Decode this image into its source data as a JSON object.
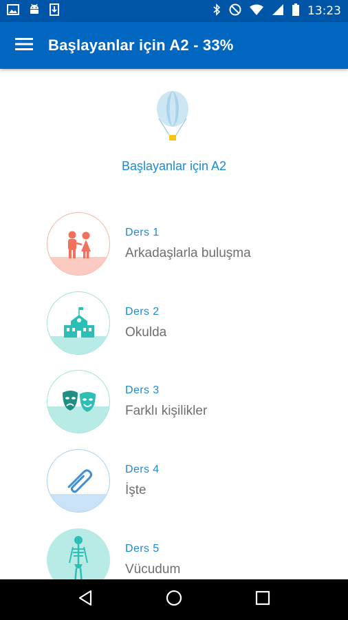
{
  "status_bar": {
    "time": "13:23",
    "left_icons": [
      "image-icon",
      "android-icon",
      "download-icon"
    ],
    "right_icons": [
      "bluetooth-icon",
      "do-not-disturb-icon",
      "wifi-icon",
      "signal-icon",
      "battery-icon"
    ]
  },
  "app_bar": {
    "title": "Başlayanlar için A2 - 33%",
    "background": "#0066c0"
  },
  "course": {
    "title": "Başlayanlar için A2",
    "icon": "hot-air-balloon-icon",
    "flag": "uk-flag-icon"
  },
  "lessons": [
    {
      "number": "Ders 1",
      "name": "Arkadaşlarla buluşma",
      "icon": "friends-icon",
      "color": "#f2705c"
    },
    {
      "number": "Ders 2",
      "name": "Okulda",
      "icon": "school-icon",
      "color": "#2dbfb6"
    },
    {
      "number": "Ders 3",
      "name": "Farklı kişilikler",
      "icon": "theater-masks-icon",
      "color": "#23a79a"
    },
    {
      "number": "Ders 4",
      "name": "İşte",
      "icon": "paperclip-icon",
      "color": "#3f8fd6"
    },
    {
      "number": "Ders 5",
      "name": "Vücudum",
      "icon": "skeleton-icon",
      "color": "#2dbfb6"
    }
  ],
  "colors": {
    "accent": "#1a8ad4",
    "status_bar": "#0055a6",
    "secondary_text": "#6f6f6f"
  },
  "nav_bar": {
    "buttons": [
      "back-icon",
      "home-icon",
      "recents-icon"
    ]
  }
}
